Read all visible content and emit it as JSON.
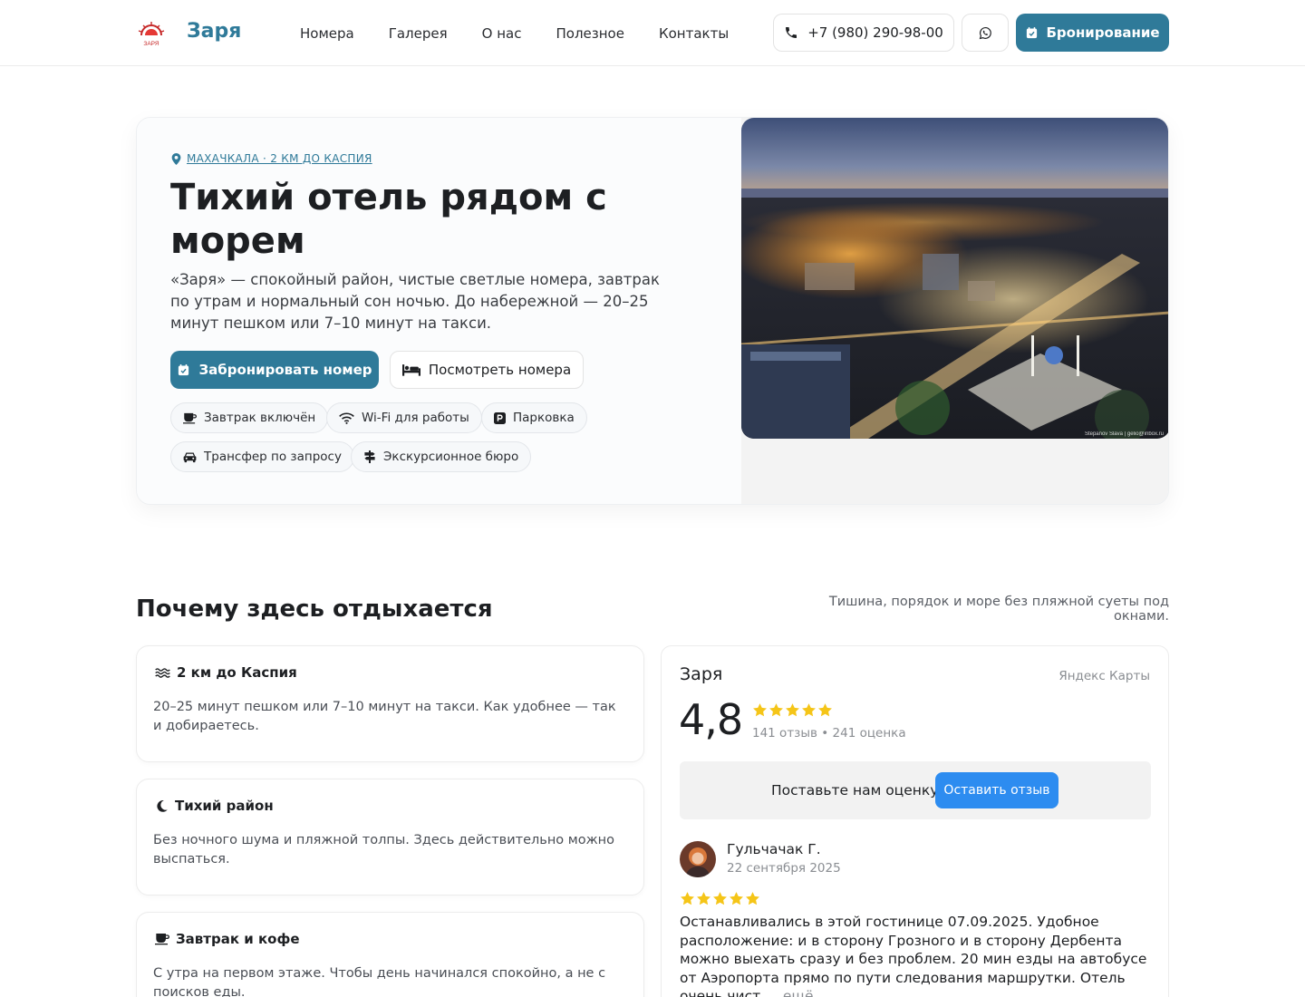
{
  "header": {
    "brand": "Заря",
    "logo_text": "ЗАРЯ",
    "nav": [
      "Номера",
      "Галерея",
      "О нас",
      "Полезное",
      "Контакты"
    ],
    "phone": "+7 (980) 290-98-00",
    "book_label": "Бронирование"
  },
  "hero": {
    "location": "МАХАЧКАЛА · 2 КМ ДО КАСПИЯ",
    "title": "Тихий отель рядом с морем",
    "description": "«Заря» — спокойный район, чистые светлые номера, завтрак по утрам и нормальный сон ночью. До набережной — 20–25 минут пешком или 7–10 минут на такси.",
    "primary_button": "Забронировать номер",
    "secondary_button": "Посмотреть номера",
    "chips": [
      "Завтрак включён",
      "Wi-Fi для работы",
      "Парковка",
      "Трансфер по запросу",
      "Экскурсионное бюро"
    ],
    "photo_credit": "Stepanov Slava | gelio@inbox.ru"
  },
  "section": {
    "title": "Почему здесь отдыхается",
    "subtitle": "Тишина, порядок и море без пляжной суеты под окнами."
  },
  "features": [
    {
      "title": "2 км до Каспия",
      "text": "20–25 минут пешком или 7–10 минут на такси. Как удобнее — так и добираетесь."
    },
    {
      "title": "Тихий район",
      "text": "Без ночного шума и пляжной толпы. Здесь действительно можно выспаться."
    },
    {
      "title": "Завтрак и кофе",
      "text": "С утра на первом этаже. Чтобы день начинался спокойно, а не с поисков еды."
    }
  ],
  "review_widget": {
    "name": "Заря",
    "source": "Яндекс Карты",
    "score": "4,8",
    "counts": "141 отзыв • 241 оценка",
    "rating_stars": 5,
    "cta_text": "Поставьте нам оценку",
    "cta_button": "Оставить отзыв",
    "review": {
      "author": "Гульчачак Г.",
      "date": "22 сентября 2025",
      "stars": 5,
      "text": "Останавливались в этой гостинице 07.09.2025. Удобное расположение: и в сторону Грозного и в сторону Дербента можно выехать сразу и без проблем. 20 мин езды на автобусе от Аэропорта прямо по пути следования маршрутки. Отель очень чист",
      "ellipsis": "...",
      "more": "ещё"
    }
  },
  "colors": {
    "accent": "#2f7a99",
    "star": "#f5c518",
    "review_button": "#2d8cf0"
  }
}
